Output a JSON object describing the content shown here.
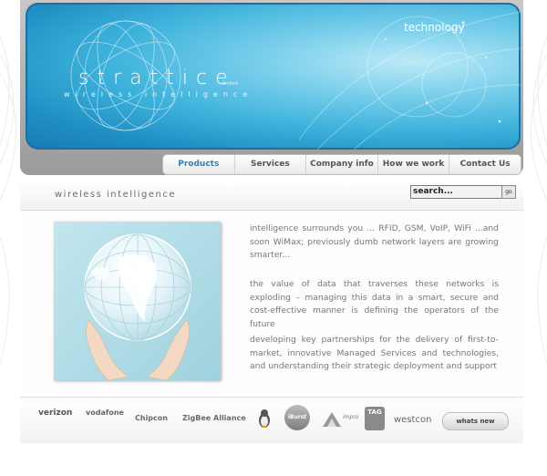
{
  "banner": {
    "logo": "strattice",
    "logo_tm": "limited",
    "logo_sub": "wireless intelligence",
    "tech_label": "technology"
  },
  "nav": {
    "items": [
      "Products",
      "Services",
      "Company info",
      "How we work",
      "Contact Us"
    ],
    "active": "Products"
  },
  "tagbar": {
    "tagline": "wireless intelligence",
    "search_value": "search...",
    "go_label": "go"
  },
  "content": {
    "paragraphs": [
      "intelligence surrounds you ... RFID, GSM, VoIP, WiFi ...and soon WiMax; previously dumb network layers are growing smarter...",
      "the value of data that traverses these networks is exploding – managing this data in a smart, secure and cost-effective manner is defining the operators of the future",
      "developing key partnerships for the delivery of first-to-market, innovative Managed Services and technologies, and understanding their strategic deployment and support"
    ]
  },
  "partners": {
    "verizon": "verizon",
    "vodafone": "vodafone",
    "chipcon": "Chipcon",
    "zigbee": "ZigBee Alliance",
    "linux": "linux-penguin-icon",
    "iburst": "iBurst",
    "impro": "impro",
    "tag": "TAG",
    "westcon": "westcon"
  },
  "footer": {
    "whats_new": "whats new"
  },
  "colors": {
    "banner_blue": "#2a9fd2",
    "nav_active": "#2a84b9",
    "text_grey": "#777777"
  }
}
